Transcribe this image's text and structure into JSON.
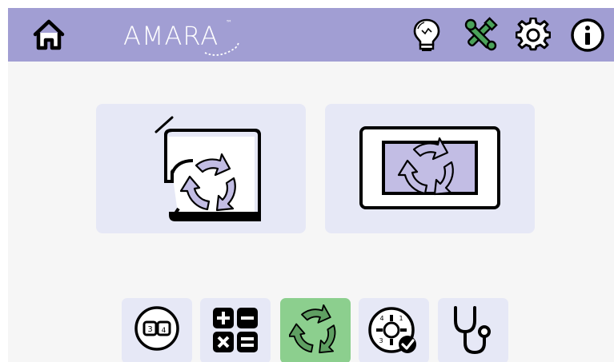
{
  "header": {
    "brand": "AMARA",
    "brand_tm": "™",
    "background": "#a19ed3",
    "icons": [
      "home-icon",
      "lightbulb-icon",
      "tools-icon",
      "gear-icon",
      "info-icon"
    ]
  },
  "main": {
    "cards": [
      {
        "name": "machine-update",
        "icon": "sewing-machine-refresh-icon"
      },
      {
        "name": "screen-update",
        "icon": "screen-refresh-icon"
      }
    ]
  },
  "toolbar": {
    "items": [
      {
        "name": "unit-converter",
        "icon": "conversion-icon",
        "active": false
      },
      {
        "name": "calculator",
        "icon": "calculator-icon",
        "active": false
      },
      {
        "name": "update",
        "icon": "refresh-icon",
        "active": true
      },
      {
        "name": "dial-settings",
        "icon": "dial-check-icon",
        "active": false
      },
      {
        "name": "diagnostics",
        "icon": "stethoscope-icon",
        "active": false
      }
    ],
    "dial_numbers": [
      "4",
      "1",
      "3"
    ],
    "converter_numbers": [
      "3",
      "4"
    ],
    "active_color": "#8ccf8e"
  },
  "colors": {
    "accent": "#a19ed3",
    "card": "#e6e8f6",
    "arrow_fill": "#c2bde4"
  }
}
